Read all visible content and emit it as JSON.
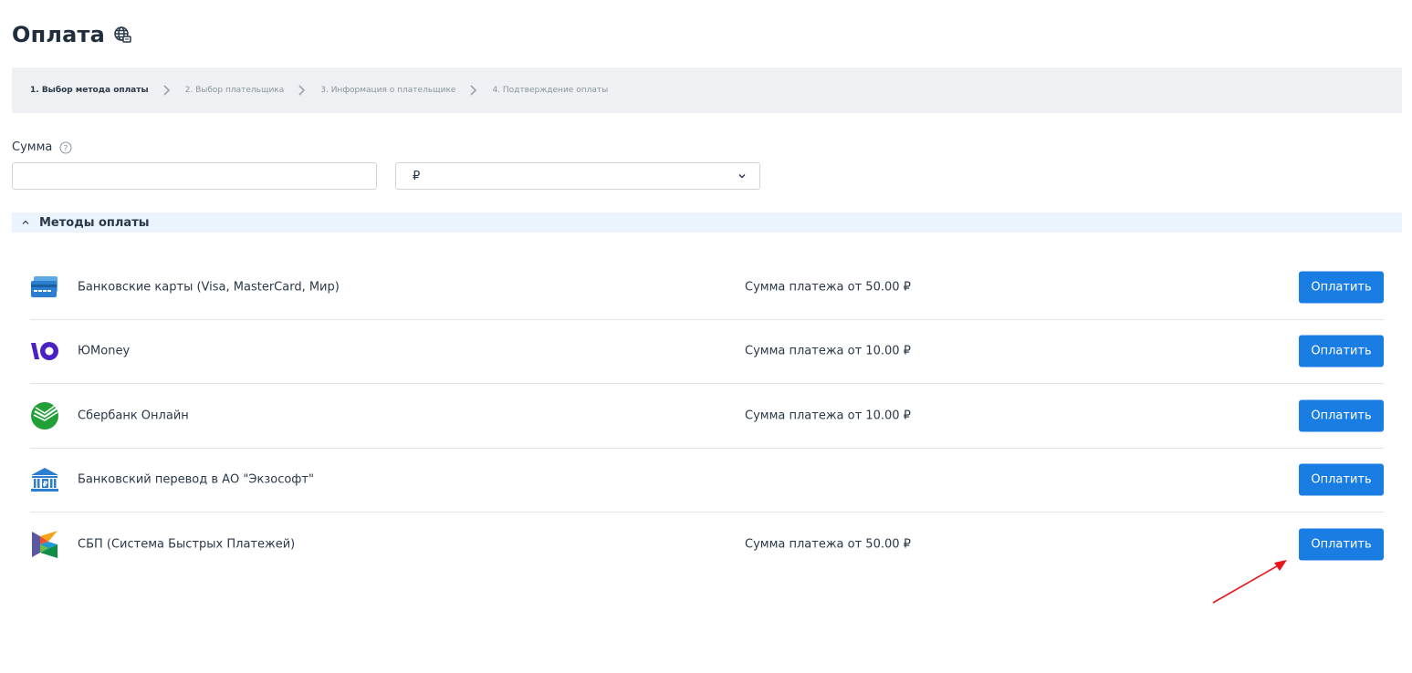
{
  "header": {
    "title": "Оплата",
    "icon": "globe-icon"
  },
  "stepper": {
    "steps": [
      {
        "label": "1. Выбор метода оплаты",
        "active": true
      },
      {
        "label": "2. Выбор плательщика",
        "active": false
      },
      {
        "label": "3. Информация о плательщике",
        "active": false
      },
      {
        "label": "4. Подтверждение оплаты",
        "active": false
      }
    ]
  },
  "amount": {
    "label": "Сумма",
    "value": "",
    "placeholder": ""
  },
  "currency": {
    "selected": "₽"
  },
  "methods_section": {
    "title": "Методы оплаты",
    "expanded": true,
    "items": [
      {
        "name": "Банковские карты (Visa, MasterCard, Мир)",
        "min": "Сумма платежа от 50.00 ₽",
        "button": "Оплатить",
        "icon": "bank-card-icon"
      },
      {
        "name": "ЮMoney",
        "min": "Сумма платежа от 10.00 ₽",
        "button": "Оплатить",
        "icon": "yoomoney-icon"
      },
      {
        "name": "Сбербанк Онлайн",
        "min": "Сумма платежа от 10.00 ₽",
        "button": "Оплатить",
        "icon": "sberbank-icon"
      },
      {
        "name": "Банковский перевод в АО \"Экзософт\"",
        "min": "",
        "button": "Оплатить",
        "icon": "bank-building-icon"
      },
      {
        "name": "СБП (Система Быстрых Платежей)",
        "min": "Сумма платежа от 50.00 ₽",
        "button": "Оплатить",
        "icon": "sbp-icon"
      }
    ]
  },
  "colors": {
    "primary": "#1a7de3",
    "section_bg": "#ebf3fc",
    "stepper_bg": "#eef0f3",
    "annotation": "#e8161b"
  }
}
